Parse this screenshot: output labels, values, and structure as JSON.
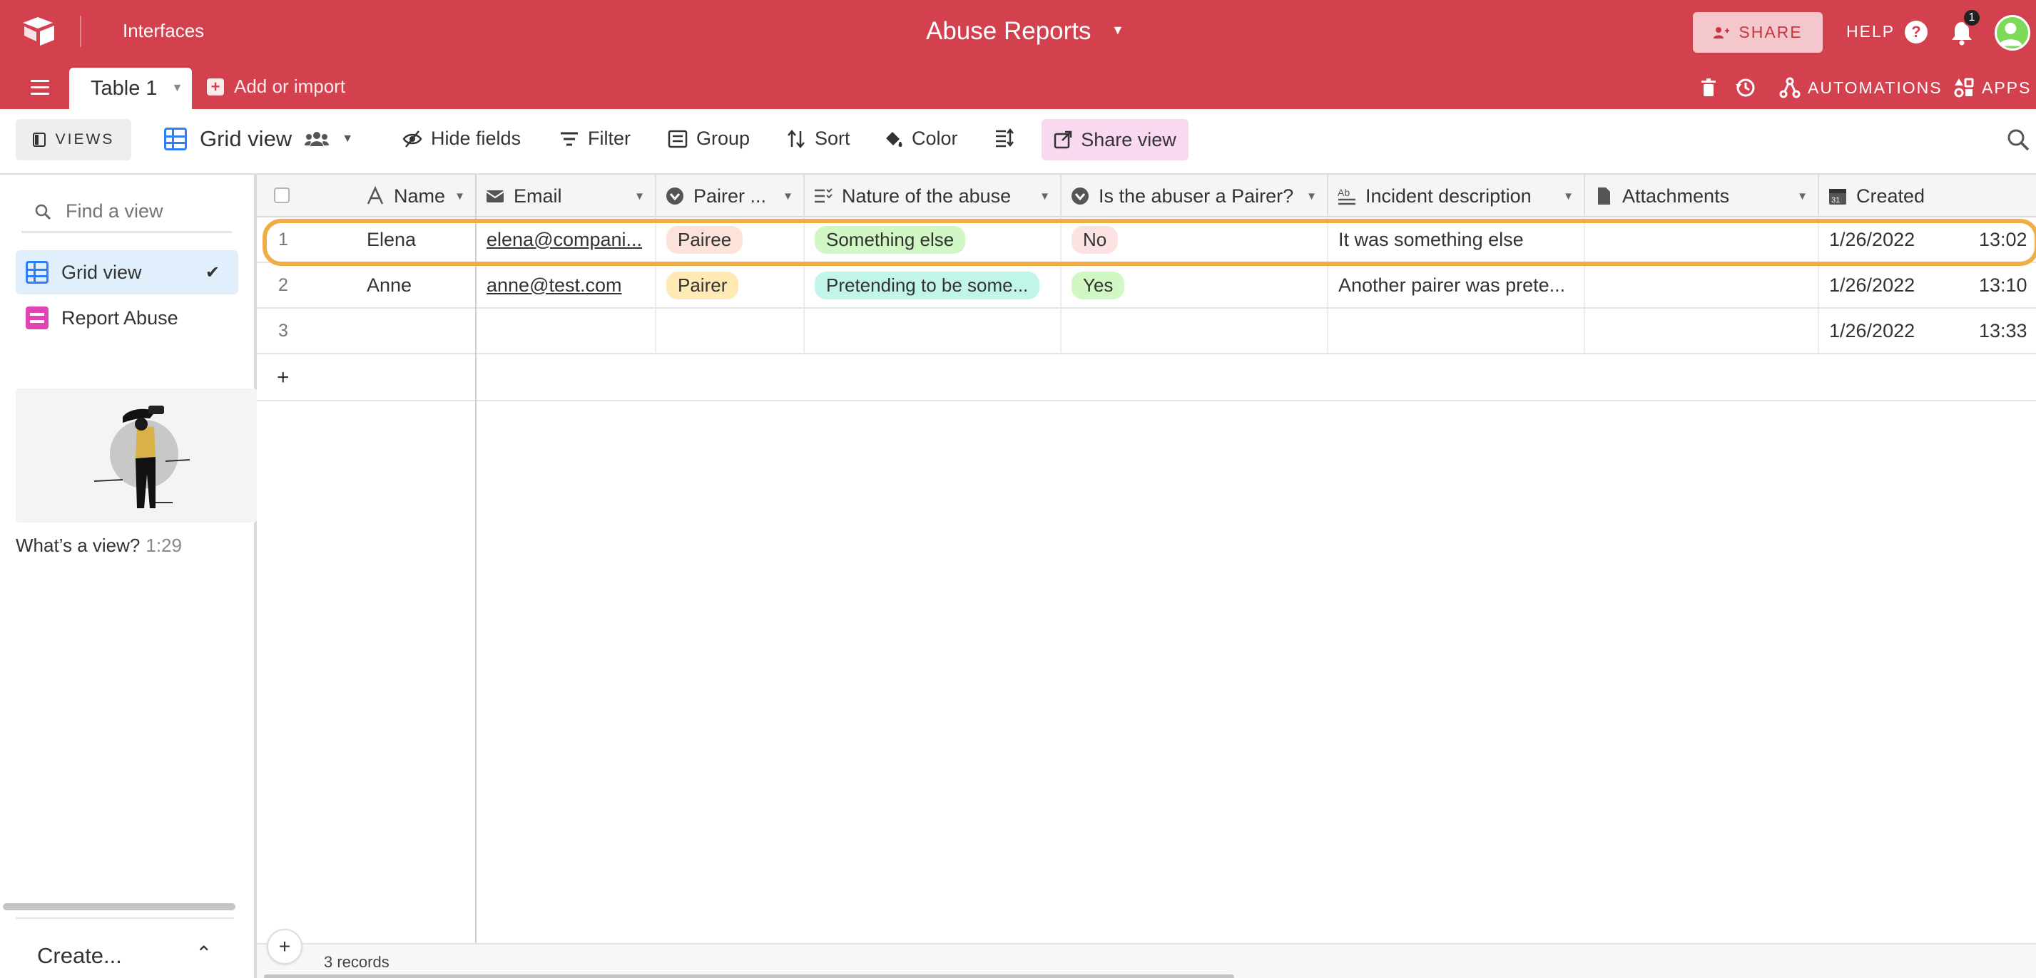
{
  "topbar": {
    "interfaces_label": "Interfaces",
    "base_title": "Abuse Reports",
    "share_label": "SHARE",
    "help_label": "HELP",
    "notification_count": "1",
    "table_tab": "Table 1",
    "add_import_label": "Add or import",
    "automations_label": "AUTOMATIONS",
    "apps_label": "APPS",
    "brand_color": "#d3414f"
  },
  "toolbar": {
    "views_label": "VIEWS",
    "current_view": "Grid view",
    "hide_fields": "Hide fields",
    "filter": "Filter",
    "group": "Group",
    "sort": "Sort",
    "color": "Color",
    "share_view": "Share view"
  },
  "sidebar": {
    "find_placeholder": "Find a view",
    "views": [
      {
        "label": "Grid view",
        "icon": "grid-view-icon",
        "selected": true
      },
      {
        "label": "Report Abuse",
        "icon": "form-view-icon",
        "selected": false
      }
    ],
    "video_caption": "What’s a view?",
    "video_duration": "1:29",
    "create_label": "Create..."
  },
  "grid": {
    "columns": [
      {
        "label": "Name",
        "icon": "text-field-icon"
      },
      {
        "label": "Email",
        "icon": "email-field-icon"
      },
      {
        "label": "Pairer ...",
        "icon": "single-select-icon"
      },
      {
        "label": "Nature of the abuse",
        "icon": "multi-select-icon"
      },
      {
        "label": "Is the abuser a Pairer?",
        "icon": "single-select-icon"
      },
      {
        "label": "Incident description",
        "icon": "long-text-icon"
      },
      {
        "label": "Attachments",
        "icon": "attachment-icon"
      },
      {
        "label": "Created",
        "icon": "created-time-icon"
      }
    ],
    "rows": [
      {
        "num": "1",
        "name": "Elena",
        "email": "elena@compani...",
        "pairer": "Pairee",
        "nature": "Something else",
        "abuser": "No",
        "description": "It was something else",
        "attachments": "",
        "created_date": "1/26/2022",
        "created_time": "13:02"
      },
      {
        "num": "2",
        "name": "Anne",
        "email": "anne@test.com",
        "pairer": "Pairer",
        "nature": "Pretending to be some...",
        "abuser": "Yes",
        "description": "Another pairer was prete...",
        "attachments": "",
        "created_date": "1/26/2022",
        "created_time": "13:10"
      },
      {
        "num": "3",
        "name": "",
        "email": "",
        "pairer": "",
        "nature": "",
        "abuser": "",
        "description": "",
        "attachments": "",
        "created_date": "1/26/2022",
        "created_time": "13:33"
      }
    ],
    "pill_colors": {
      "Pairee": "#fde2da",
      "Pairer": "#ffeab6",
      "Something else": "#d1f7c4",
      "Pretending to be some...": "#c2f5e9",
      "No": "#fde2e4",
      "Yes": "#d1f7c4"
    },
    "highlight_color": "#f0ac45",
    "add_row_symbol": "+",
    "records_label": "3 records"
  }
}
